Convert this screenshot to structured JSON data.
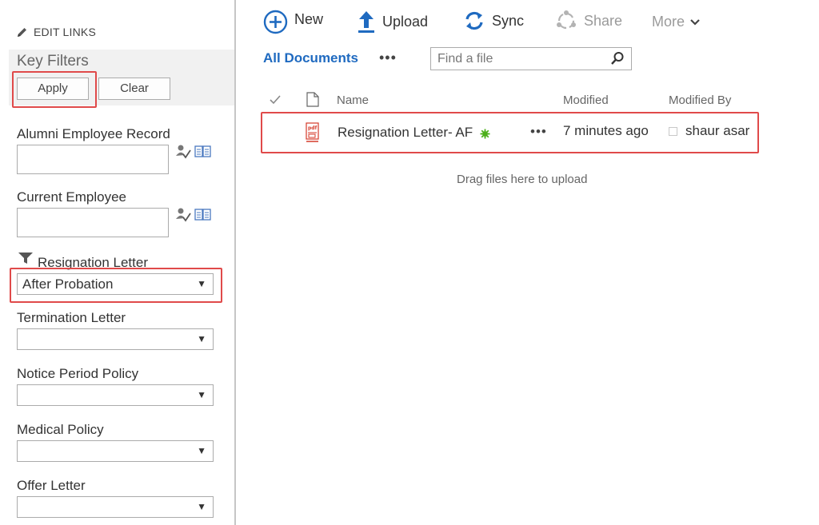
{
  "sidebar": {
    "edit_links": "EDIT LINKS",
    "key_filters": {
      "title": "Key Filters",
      "apply_label": "Apply",
      "clear_label": "Clear"
    },
    "filters": [
      {
        "label": "Alumni Employee Record",
        "type": "people",
        "value": ""
      },
      {
        "label": "Current Employee",
        "type": "people",
        "value": ""
      },
      {
        "label": "Resignation Letter",
        "type": "select",
        "value": "After Probation",
        "filtered": true
      },
      {
        "label": "Termination Letter",
        "type": "select",
        "value": ""
      },
      {
        "label": "Notice Period Policy",
        "type": "select",
        "value": ""
      },
      {
        "label": "Medical Policy",
        "type": "select",
        "value": ""
      },
      {
        "label": "Offer Letter",
        "type": "select",
        "value": ""
      }
    ],
    "dropdown_arrow": "▼"
  },
  "toolbar": {
    "new_label": "New",
    "upload_label": "Upload",
    "sync_label": "Sync",
    "share_label": "Share",
    "more_label": "More"
  },
  "view": {
    "name": "All Documents",
    "more_dots": "•••",
    "search_placeholder": "Find a file"
  },
  "list": {
    "columns": {
      "name": "Name",
      "modified": "Modified",
      "modified_by": "Modified By"
    },
    "rows": [
      {
        "name": "Resignation Letter- AF",
        "dots": "•••",
        "modified": "7 minutes ago",
        "modified_by": "shaur asar"
      }
    ],
    "drag_text": "Drag files here to upload"
  },
  "colors": {
    "accent": "#1f6ac0",
    "highlight": "#e04a4a",
    "new_badge": "#4caf1a",
    "pdf_red": "#d43a2a"
  }
}
